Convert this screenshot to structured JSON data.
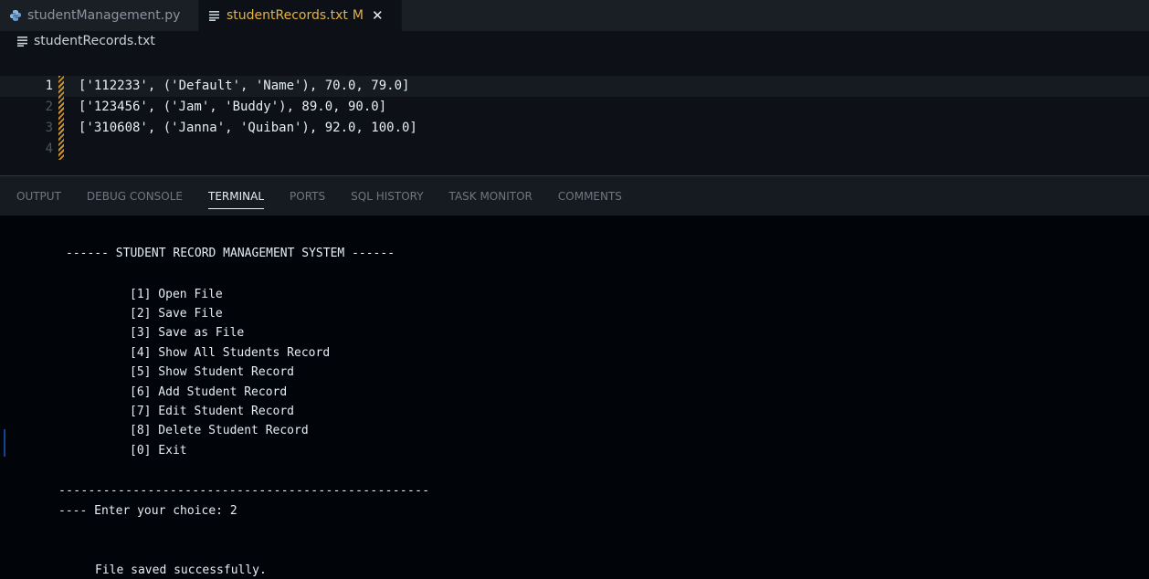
{
  "tabs": [
    {
      "label": "studentManagement.py",
      "icon": "python-file-icon"
    },
    {
      "label": "studentRecords.txt",
      "icon": "text-file-icon",
      "status": "M",
      "close": "✕"
    }
  ],
  "breadcrumb": {
    "label": "studentRecords.txt",
    "icon": "text-file-icon"
  },
  "editor": {
    "lines": [
      {
        "num": "1",
        "code": "['112233', ('Default', 'Name'), 70.0, 79.0]"
      },
      {
        "num": "2",
        "code": "['123456', ('Jam', 'Buddy'), 89.0, 90.0]"
      },
      {
        "num": "3",
        "code": "['310608', ('Janna', 'Quiban'), 92.0, 100.0]"
      },
      {
        "num": "4",
        "code": ""
      }
    ]
  },
  "panel": {
    "tabs": [
      "OUTPUT",
      "DEBUG CONSOLE",
      "TERMINAL",
      "PORTS",
      "SQL HISTORY",
      "TASK MONITOR",
      "COMMENTS"
    ],
    "active": "TERMINAL"
  },
  "terminal": {
    "header": "------ STUDENT RECORD MANAGEMENT SYSTEM ------",
    "menu": [
      "[1] Open File",
      "[2] Save File",
      "[3] Save as File",
      "[4] Show All Students Record",
      "[5] Show Student Record",
      "[6] Add Student Record",
      "[7] Edit Student Record",
      "[8] Delete Student Record",
      "[0] Exit"
    ],
    "separator": "--------------------------------------------------",
    "prompt": "---- Enter your choice: 2",
    "message": "File saved successfully."
  },
  "colors": {
    "modified": "#e3b341",
    "change_bar": "#c9922f",
    "background": "#0d1117",
    "terminal_bg": "#010409"
  }
}
